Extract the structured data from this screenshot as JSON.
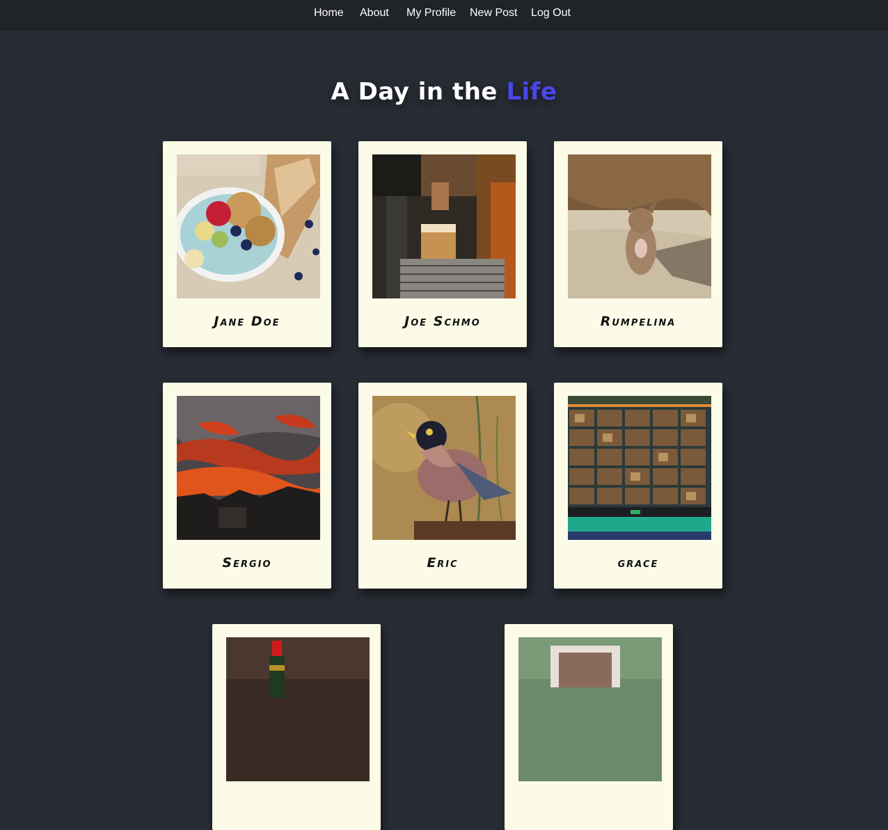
{
  "nav": {
    "home": "Home",
    "about": "About",
    "profile": "My Profile",
    "new_post": "New Post",
    "logout": "Log Out"
  },
  "title": {
    "main": "A Day in the",
    "accent": "Life",
    "accent_color": "#4a47e8"
  },
  "posts": [
    {
      "name": "Jane Doe",
      "photo": "granola-bowl-photo"
    },
    {
      "name": "Joe Schmo",
      "photo": "espresso-machine-photo"
    },
    {
      "name": "Rumpelina",
      "photo": "dog-on-sand-photo"
    },
    {
      "name": "Sergio",
      "photo": "sunset-sky-photo"
    },
    {
      "name": "Eric",
      "photo": "bird-photo"
    },
    {
      "name": "grace",
      "photo": "video-call-screen-photo"
    },
    {
      "name": "",
      "photo": "bottle-photo"
    },
    {
      "name": "",
      "photo": "portrait-frame-photo"
    }
  ],
  "colors": {
    "background": "#282c34",
    "navbar": "#202327",
    "card": "#fcfbe8"
  }
}
